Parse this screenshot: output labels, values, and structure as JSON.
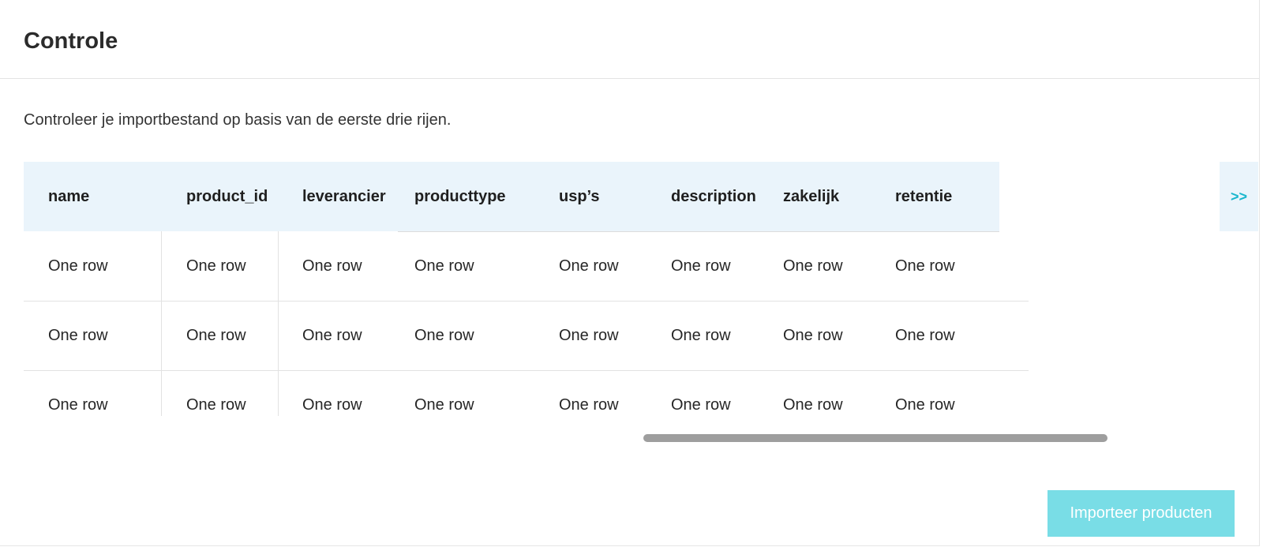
{
  "header": {
    "title": "Controle"
  },
  "intro": "Controleer je importbestand op basis van de eerste drie rijen.",
  "table": {
    "columns": [
      "name",
      "product_id",
      "leverancier",
      "producttype",
      "usp’s",
      "description",
      "zakelijk",
      "retentie"
    ],
    "rows": [
      [
        "One row",
        "One row",
        "One row",
        "One row",
        "One row",
        "One row",
        "One row",
        "One row"
      ],
      [
        "One row",
        "One row",
        "One row",
        "One row",
        "One row",
        "One row",
        "One row",
        "One row"
      ],
      [
        "One row",
        "One row",
        "One row",
        "One row",
        "One row",
        "One row",
        "One row",
        "One row"
      ]
    ]
  },
  "scroll_next_label": ">>",
  "footer": {
    "import_button_label": "Importeer producten"
  },
  "colors": {
    "header_bg": "#eaf4fb",
    "accent": "#19b6cd",
    "button_bg": "#79dde6",
    "scrollbar": "#9e9e9e"
  }
}
